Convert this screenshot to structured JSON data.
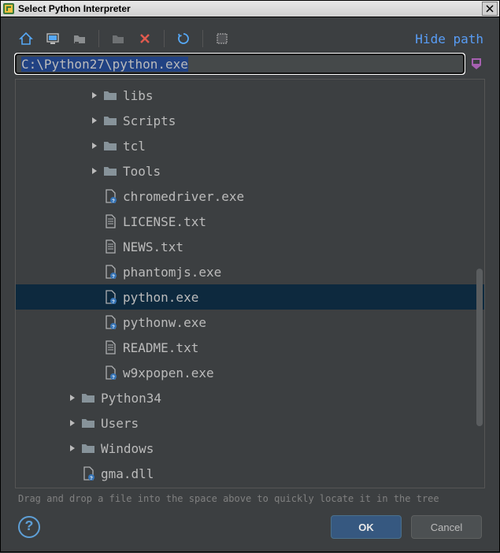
{
  "window": {
    "title": "Select Python Interpreter"
  },
  "toolbar": {
    "hide_path": "Hide path"
  },
  "path": {
    "value": "C:\\Python27\\python.exe"
  },
  "tree": [
    {
      "depth": 3,
      "arrow": "right",
      "icon": "folder",
      "label": "libs",
      "selected": false
    },
    {
      "depth": 3,
      "arrow": "right",
      "icon": "folder",
      "label": "Scripts",
      "selected": false
    },
    {
      "depth": 3,
      "arrow": "right",
      "icon": "folder",
      "label": "tcl",
      "selected": false
    },
    {
      "depth": 3,
      "arrow": "right",
      "icon": "folder",
      "label": "Tools",
      "selected": false
    },
    {
      "depth": 3,
      "arrow": "",
      "icon": "file-unknown",
      "label": "chromedriver.exe",
      "selected": false
    },
    {
      "depth": 3,
      "arrow": "",
      "icon": "file-text",
      "label": "LICENSE.txt",
      "selected": false
    },
    {
      "depth": 3,
      "arrow": "",
      "icon": "file-text",
      "label": "NEWS.txt",
      "selected": false
    },
    {
      "depth": 3,
      "arrow": "",
      "icon": "file-unknown",
      "label": "phantomjs.exe",
      "selected": false
    },
    {
      "depth": 3,
      "arrow": "",
      "icon": "file-unknown",
      "label": "python.exe",
      "selected": true
    },
    {
      "depth": 3,
      "arrow": "",
      "icon": "file-unknown",
      "label": "pythonw.exe",
      "selected": false
    },
    {
      "depth": 3,
      "arrow": "",
      "icon": "file-text",
      "label": "README.txt",
      "selected": false
    },
    {
      "depth": 3,
      "arrow": "",
      "icon": "file-unknown",
      "label": "w9xpopen.exe",
      "selected": false
    },
    {
      "depth": 2,
      "arrow": "right",
      "icon": "folder",
      "label": "Python34",
      "selected": false
    },
    {
      "depth": 2,
      "arrow": "right",
      "icon": "folder",
      "label": "Users",
      "selected": false
    },
    {
      "depth": 2,
      "arrow": "right",
      "icon": "folder",
      "label": "Windows",
      "selected": false
    },
    {
      "depth": 2,
      "arrow": "",
      "icon": "file-unknown",
      "label": "gma.dll",
      "selected": false
    }
  ],
  "hint": "Drag and drop a file into the space above to quickly locate it in the tree",
  "buttons": {
    "ok": "OK",
    "cancel": "Cancel"
  }
}
